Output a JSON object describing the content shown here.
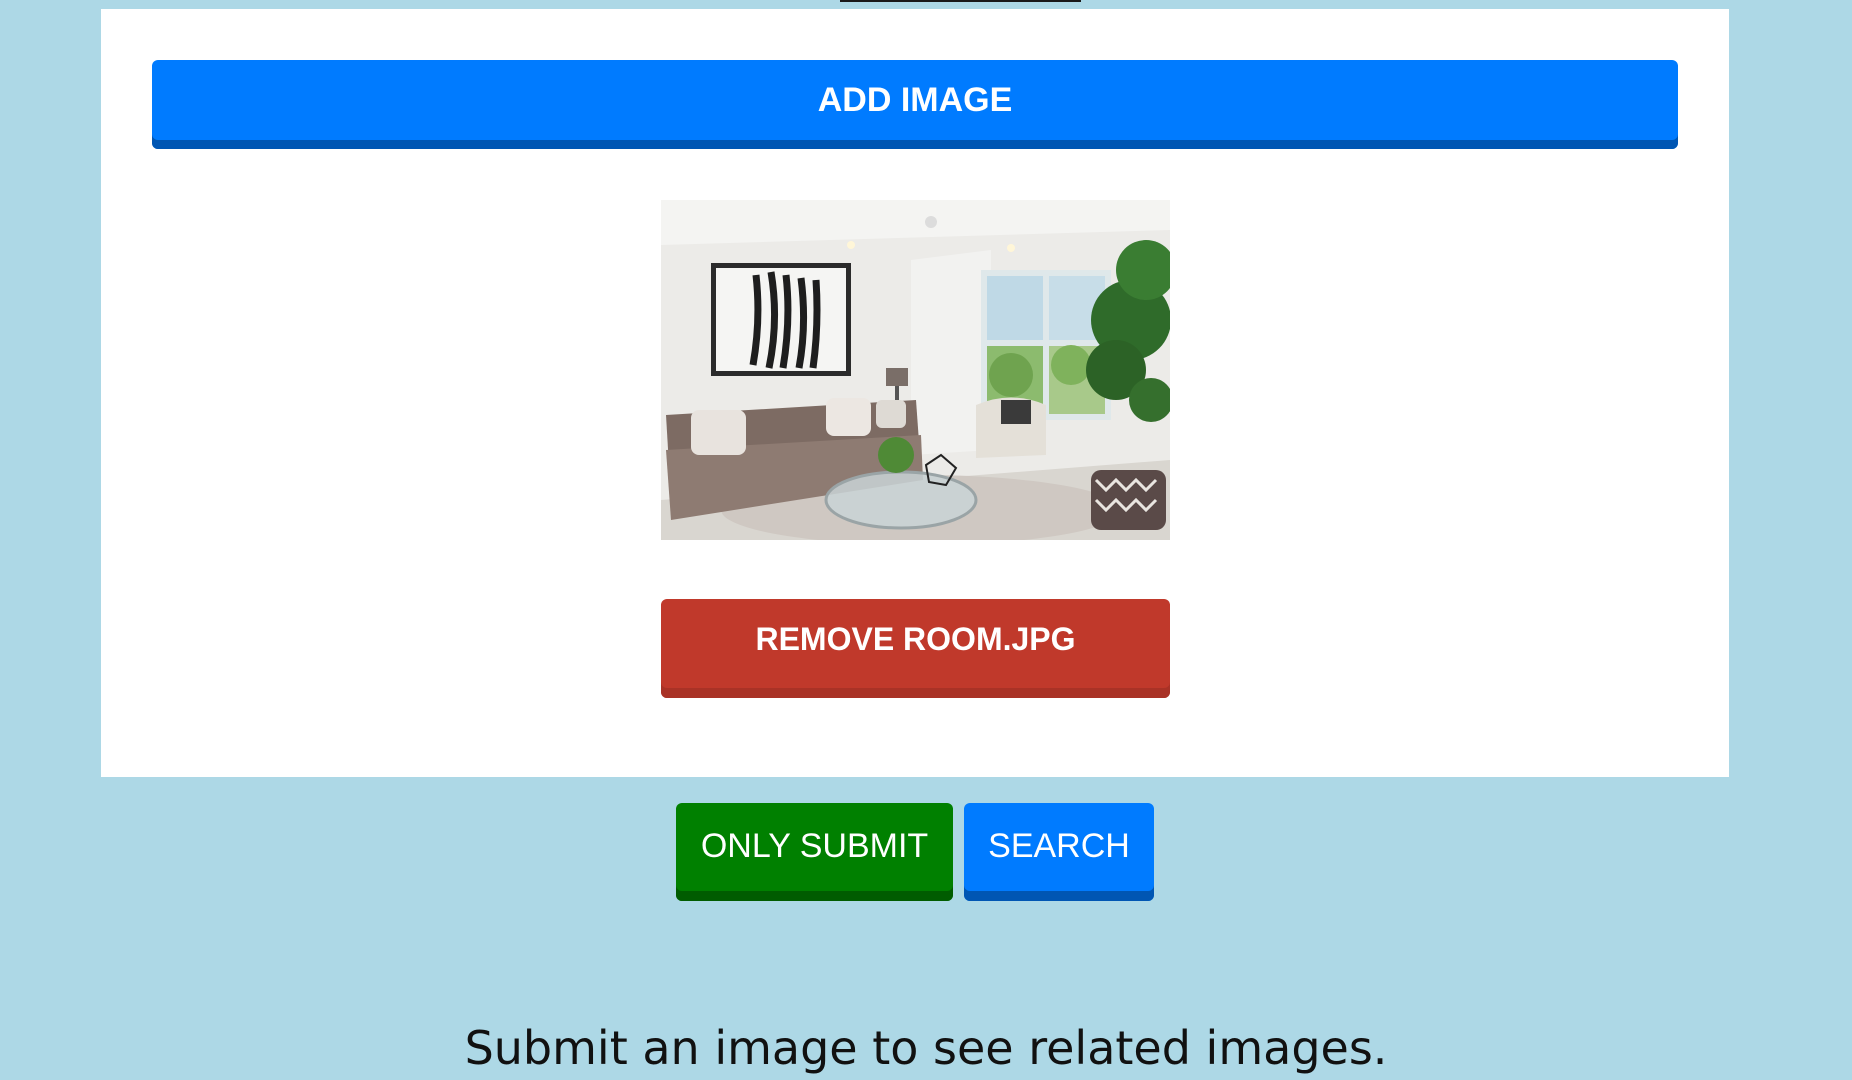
{
  "upload": {
    "add_label": "ADD IMAGE",
    "preview_icon": "room-photo",
    "remove_label": "REMOVE ROOM.JPG"
  },
  "actions": {
    "submit_label": "ONLY SUBMIT",
    "search_label": "SEARCH"
  },
  "results": {
    "empty_message": "Submit an image to see related images."
  },
  "colors": {
    "page_background": "#add8e6",
    "primary": "#007bff",
    "danger": "#c0392b",
    "success": "#008000"
  }
}
